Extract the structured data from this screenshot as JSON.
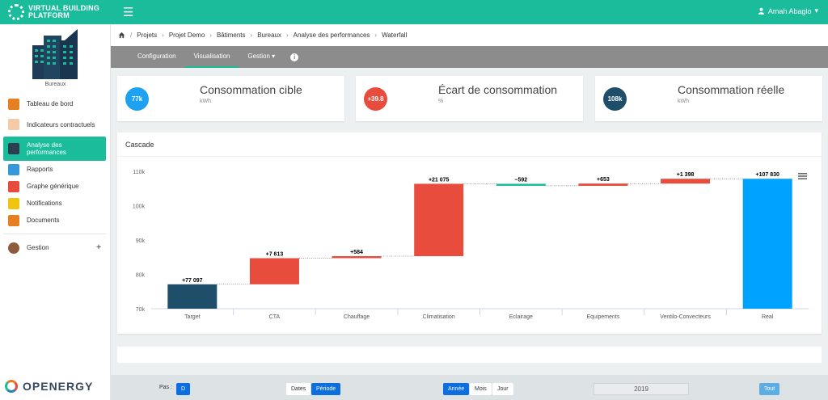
{
  "brand": {
    "line1": "VIRTUAL BUILDING",
    "line2": "PLATFORM"
  },
  "user": {
    "name": "Amah Abaglo"
  },
  "sidebar": {
    "building_label": "Bureaux",
    "items": [
      {
        "label": "Tableau de bord",
        "icon": "dashboard-icon",
        "color": "#e67e22"
      },
      {
        "label": "Indicateurs contractuels",
        "icon": "contract-icon",
        "color": "#f5cba7"
      },
      {
        "label": "Analyse des performances",
        "icon": "performance-icon",
        "color": "#2c3e50",
        "active": true
      },
      {
        "label": "Rapports",
        "icon": "reports-icon",
        "color": "#3498db"
      },
      {
        "label": "Graphe générique",
        "icon": "chart-icon",
        "color": "#e74c3c"
      },
      {
        "label": "Notifications",
        "icon": "bell-icon",
        "color": "#f1c40f"
      },
      {
        "label": "Documents",
        "icon": "document-icon",
        "color": "#e67e22"
      }
    ],
    "gestion": {
      "label": "Gestion",
      "plus": "+"
    },
    "bottom_logo": "OPENERGY"
  },
  "breadcrumb": [
    "Projets",
    "Projet Demo",
    "Bâtiments",
    "Bureaux",
    "Analyse des performances",
    "Waterfall"
  ],
  "tabs": [
    {
      "label": "Configuration"
    },
    {
      "label": "Visualisation",
      "active": true
    },
    {
      "label": "Gestion ▾"
    }
  ],
  "info_label": "i",
  "kpis": [
    {
      "value": "77k",
      "title": "Consommation cible",
      "unit": "kWh",
      "color": "#1da1f2"
    },
    {
      "value": "+39.8",
      "title": "Écart de consommation",
      "unit": "%",
      "color": "#e74c3c"
    },
    {
      "value": "108k",
      "title": "Consommation réelle",
      "unit": "kWh",
      "color": "#1f4e6b"
    }
  ],
  "chart_card": {
    "title": "Cascade",
    "menu_icon": "menu-icon"
  },
  "chart_data": {
    "type": "bar",
    "subtype": "waterfall",
    "title": "Cascade",
    "categories": [
      "Target",
      "CTA",
      "Chauffage",
      "Climatisation",
      "Eclairage",
      "Equipements",
      "Ventilo-Convecteurs",
      "Real"
    ],
    "values": [
      77097,
      7613,
      584,
      21075,
      -592,
      653,
      1398,
      107830
    ],
    "labels": [
      "+77 097",
      "+7 613",
      "+584",
      "+21 075",
      "−592",
      "+653",
      "+1 398",
      "+107 830"
    ],
    "kinds": [
      "total",
      "delta",
      "delta",
      "delta",
      "delta",
      "delta",
      "delta",
      "total"
    ],
    "colors": [
      "#1f4e6b",
      "#e74c3c",
      "#e74c3c",
      "#e74c3c",
      "#1abc9c",
      "#e74c3c",
      "#e74c3c",
      "#00a2ff"
    ],
    "yticks": [
      "70k",
      "80k",
      "90k",
      "100k",
      "110k"
    ],
    "ylim": [
      70000,
      110000
    ],
    "grid": false,
    "legend": "none"
  },
  "bottombar": {
    "pas_label": "Pas :",
    "pas_value": "D",
    "dates_label": "Dates",
    "periode_label": "Période",
    "annee_label": "Année",
    "mois_label": "Mois",
    "jour_label": "Jour",
    "year": "2019",
    "tout_label": "Tout"
  }
}
